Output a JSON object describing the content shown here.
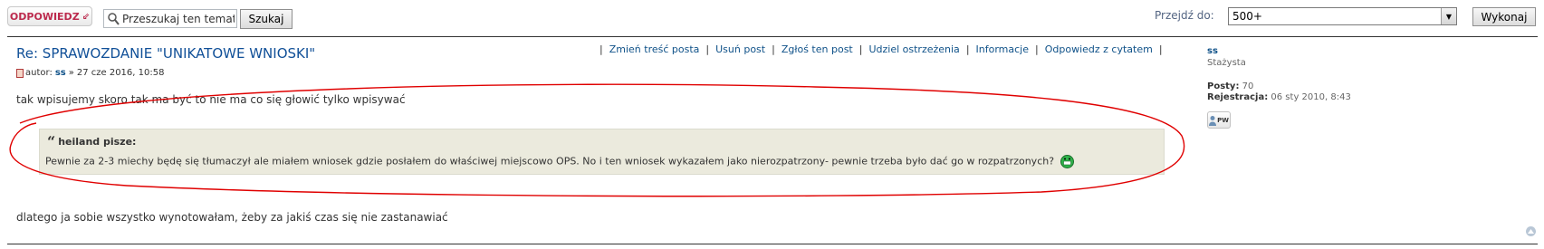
{
  "toolbar": {
    "reply_label": "ODPOWIEDZ",
    "search_placeholder": "Przeszukaj ten temat…",
    "search_value": "Przeszukaj ten temat",
    "search_button": "Szukaj",
    "jump_label": "Przejdź do:",
    "jump_selected": "500+",
    "go_button": "Wykonaj"
  },
  "post": {
    "title": "Re: SPRAWOZDANIE \"UNIKATOWE WNIOSKI\"",
    "meta_prefix": "autor:",
    "author": "ss",
    "meta_sep": "»",
    "date": "27 cze 2016, 10:58",
    "actions": [
      "Zmień treść posta",
      "Usuń post",
      "Zgłoś ten post",
      "Udziel ostrzeżenia",
      "Informacje",
      "Odpowiedz z cytatem"
    ],
    "body_1": "tak wpisujemy skoro tak ma być to nie ma co się głowić tylko wpisywać",
    "quote": {
      "cite": "heiland pisze:",
      "text": "Pewnie za 2-3 miechy będę się tłumaczył ale miałem wniosek gdzie posłałem do właściwej miejscowo OPS. No i ten wniosek wykazałem jako nierozpatrzony- pewnie trzeba było dać go w rozpatrzonych?"
    },
    "body_2": "dlatego ja sobie wszystko wynotowałam, żeby za jakiś czas się nie zastanawiać"
  },
  "profile": {
    "name": "ss",
    "rank": "Stażysta",
    "posts_label": "Posty:",
    "posts_value": "70",
    "reg_label": "Rejestracja:",
    "reg_value": "06 sty 2010, 8:43",
    "pm_label": "PW"
  },
  "colors": {
    "accent": "#bc2a4d",
    "link": "#105289",
    "quote_bg": "#ebeadd",
    "annotation": "#e00000"
  },
  "icons": [
    "search-icon",
    "doc-icon",
    "smiley-icon",
    "pm-icon",
    "top-icon"
  ]
}
